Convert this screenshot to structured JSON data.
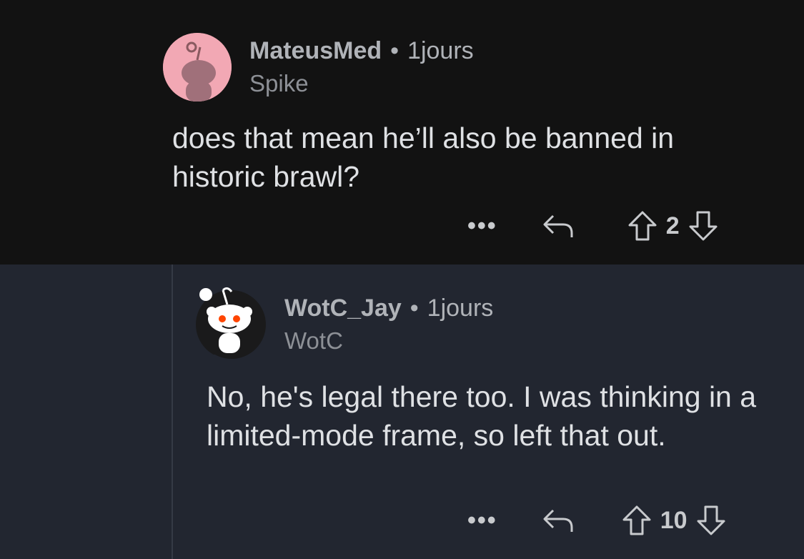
{
  "comments": [
    {
      "username": "MateusMed",
      "separator": "•",
      "age": "1jours",
      "flair": "Spike",
      "body": "does that mean he’ll also be banned in historic brawl?",
      "more": "•••",
      "score": "2",
      "avatar_bg": "#f2a8b4"
    },
    {
      "username": "WotC_Jay",
      "separator": "•",
      "age": "1jours",
      "flair": "WotC",
      "body": "No, he's legal there too. I was thinking in a limited-mode frame, so left that out.",
      "more": "•••",
      "score": "10",
      "avatar_bg": "#1a1a1b"
    }
  ],
  "icons": [
    "snoo-avatar-icon",
    "reply-icon",
    "upvote-icon",
    "downvote-icon",
    "more-options-icon"
  ],
  "colors": {
    "bg_dark": "#121212",
    "bg_reply": "#222630",
    "text": "#dfe1e4",
    "meta": "#b0b3b8",
    "snoo_eye": "#ff4500"
  }
}
